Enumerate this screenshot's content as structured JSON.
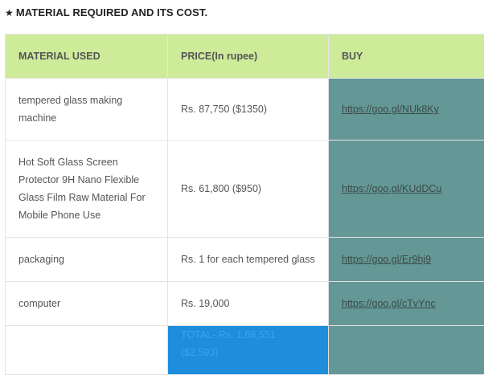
{
  "heading": {
    "star": "★",
    "text": "MATERIAL REQUIRED AND ITS COST."
  },
  "table": {
    "headers": [
      "MATERIAL USED",
      "PRICE(In rupee)",
      "BUY"
    ],
    "rows": [
      {
        "material": "tempered glass making machine",
        "price": "Rs. 87,750 ($1350)",
        "link": "https://goo.gl/NUk8Ky"
      },
      {
        "material": "Hot Soft Glass Screen Protector 9H Nano Flexible Glass Film Raw Material For Mobile Phone Use",
        "price": "Rs. 61,800 ($950)",
        "link": "https://goo.gl/KUdDCu"
      },
      {
        "material": "packaging",
        "price": "Rs. 1 for each tempered glass",
        "link": "https://goo.gl/Er9hj9"
      },
      {
        "material": "computer",
        "price": "Rs. 19,000",
        "link": "https://goo.gl/cTvYnc"
      }
    ],
    "total": {
      "material": "",
      "price": "TOTAL- Rs. 1,68,551 ($2,593)",
      "link": ""
    }
  },
  "colors": {
    "header_bg": "#ceeb9a",
    "buy_bg": "#649896",
    "total_bg": "#1d8ddc"
  }
}
